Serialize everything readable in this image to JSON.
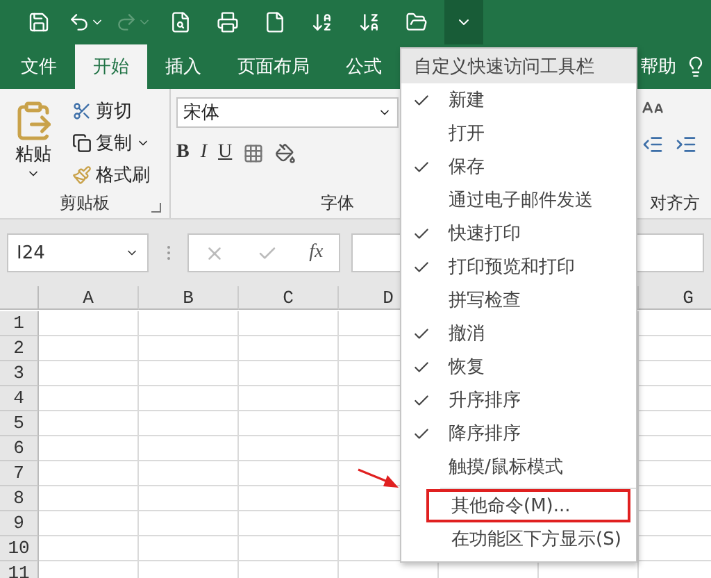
{
  "quick_access": {
    "redo_enabled": false,
    "customize_open": true
  },
  "tabs": [
    {
      "label": "文件",
      "selected": false
    },
    {
      "label": "开始",
      "selected": true
    },
    {
      "label": "插入",
      "selected": false
    },
    {
      "label": "页面布局",
      "selected": false
    },
    {
      "label": "公式",
      "selected": false
    }
  ],
  "tabs_right": [
    {
      "label": "帮助",
      "selected": false
    }
  ],
  "clipboard": {
    "paste": "粘贴",
    "cut": "剪切",
    "copy": "复制",
    "format_painter": "格式刷",
    "label": "剪贴板"
  },
  "font": {
    "name": "宋体",
    "bold": "B",
    "italic": "I",
    "underline": "U",
    "label": "字体"
  },
  "alignment": {
    "label": "对齐方"
  },
  "name_box": "I24",
  "formula_fx": "fx",
  "columns_left": [
    "A",
    "B",
    "C",
    "D"
  ],
  "columns_right": [
    "G"
  ],
  "rows": [
    "1",
    "2",
    "3",
    "4",
    "5",
    "6",
    "7",
    "8",
    "9",
    "10",
    "11"
  ],
  "menu": {
    "title": "自定义快速访问工具栏",
    "items": [
      {
        "label": "新建",
        "checked": true
      },
      {
        "label": "打开",
        "checked": false
      },
      {
        "label": "保存",
        "checked": true
      },
      {
        "label": "通过电子邮件发送",
        "checked": false
      },
      {
        "label": "快速打印",
        "checked": true
      },
      {
        "label": "打印预览和打印",
        "checked": true
      },
      {
        "label": "拼写检查",
        "checked": false
      },
      {
        "label": "撤消",
        "checked": true
      },
      {
        "label": "恢复",
        "checked": true
      },
      {
        "label": "升序排序",
        "checked": true
      },
      {
        "label": "降序排序",
        "checked": true
      },
      {
        "label": "触摸/鼠标模式",
        "checked": false
      }
    ],
    "footer_items": [
      {
        "label": "其他命令(M)...",
        "annotated": true
      },
      {
        "label": "在功能区下方显示(S)",
        "annotated": false
      }
    ]
  }
}
